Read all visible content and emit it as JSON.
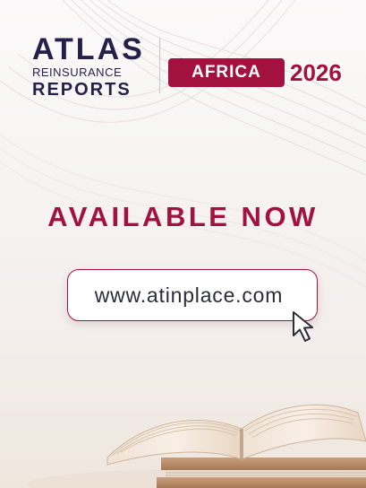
{
  "logo": {
    "line1": "ATLAS",
    "line2": "REINSURANCE",
    "line3": "REPORTS"
  },
  "edition": {
    "region": "AFRICA",
    "year": "2026"
  },
  "headline": "AVAILABLE NOW",
  "cta": {
    "url_text": "www.atinplace.com"
  },
  "colors": {
    "brand_crimson": "#a3123e",
    "navy": "#23214a"
  },
  "icons": {
    "pointer": "arrow-cursor-icon",
    "decoration": "open-book-illustration"
  }
}
